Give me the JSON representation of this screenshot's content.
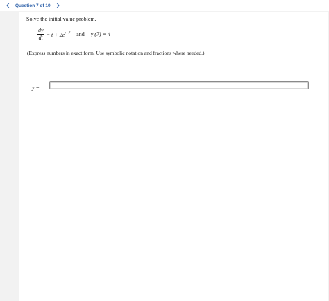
{
  "nav": {
    "question_label": "Question 7 of 10"
  },
  "problem": {
    "prompt": "Solve the initial value problem.",
    "deriv_num": "dy",
    "deriv_den": "dt",
    "rhs_pre": "= t + 2e",
    "rhs_exp": "t−7",
    "and": "and",
    "ivp": "y (7) = 4",
    "note": "(Express numbers in exact form. Use symbolic notation and fractions where needed.)"
  },
  "answer": {
    "label": "y =",
    "value": ""
  }
}
